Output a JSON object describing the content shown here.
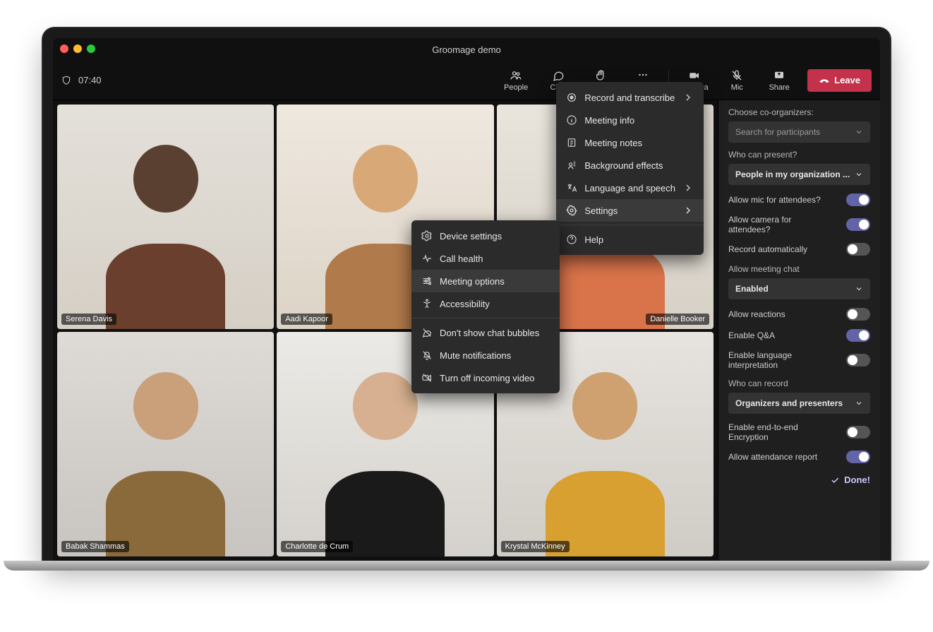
{
  "window": {
    "title": "Groomage demo"
  },
  "toolbar": {
    "time": "07:40",
    "people": "People",
    "chat": "Chat",
    "reactions": "Reactions",
    "more": "More",
    "camera": "Camera",
    "mic": "Mic",
    "share": "Share",
    "leave": "Leave"
  },
  "participants": [
    {
      "name": "Serena Davis"
    },
    {
      "name": "Aadi Kapoor"
    },
    {
      "name": "Danielle Booker"
    },
    {
      "name": "Babak Shammas"
    },
    {
      "name": "Charlotte de Crum"
    },
    {
      "name": "Krystal McKinney"
    }
  ],
  "more_menu": {
    "record": "Record and transcribe",
    "info": "Meeting info",
    "notes": "Meeting notes",
    "background": "Background effects",
    "language": "Language and speech",
    "settings": "Settings",
    "help": "Help"
  },
  "settings_menu": {
    "device": "Device settings",
    "health": "Call health",
    "options": "Meeting options",
    "accessibility": "Accessibility",
    "no_bubbles": "Don't show chat bubbles",
    "mute_notif": "Mute notifications",
    "turn_off_video": "Turn off incoming video"
  },
  "panel": {
    "choose_co": "Choose co-organizers:",
    "search_placeholder": "Search for participants",
    "who_present_label": "Who can present?",
    "who_present_value": "People in my organization ...",
    "allow_mic": "Allow mic for attendees?",
    "allow_camera": "Allow camera for attendees?",
    "record_auto": "Record automatically",
    "allow_chat_label": "Allow meeting chat",
    "allow_chat_value": "Enabled",
    "allow_reactions": "Allow reactions",
    "enable_qa": "Enable Q&A",
    "enable_interp": "Enable language interpretation",
    "who_record_label": "Who can record",
    "who_record_value": "Organizers and presenters",
    "e2e": "Enable end-to-end Encryption",
    "attendance": "Allow attendance report",
    "done": "Done!",
    "toggles": {
      "allow_mic": true,
      "allow_camera": true,
      "record_auto": false,
      "allow_reactions": false,
      "enable_qa": true,
      "enable_interp": false,
      "e2e": false,
      "attendance": true
    }
  }
}
